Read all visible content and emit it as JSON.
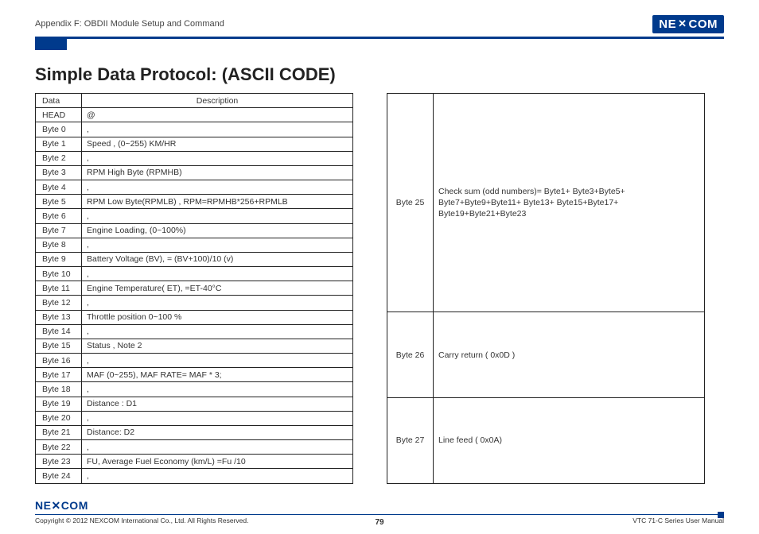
{
  "header": {
    "appendix": "Appendix F: OBDII Module Setup and Command",
    "logo_text": "NE✕COM"
  },
  "title": "Simple Data Protocol: (ASCII CODE)",
  "table_left": {
    "headers": [
      "Data",
      "Description"
    ],
    "rows": [
      [
        "HEAD",
        "@"
      ],
      [
        "Byte 0",
        ","
      ],
      [
        "Byte 1",
        "Speed , (0~255) KM/HR"
      ],
      [
        "Byte 2",
        ","
      ],
      [
        "Byte 3",
        "RPM High Byte (RPMHB)"
      ],
      [
        "Byte 4",
        ","
      ],
      [
        "Byte 5",
        "RPM Low Byte(RPMLB) , RPM=RPMHB*256+RPMLB"
      ],
      [
        "Byte 6",
        ","
      ],
      [
        "Byte 7",
        "Engine Loading, (0~100%)"
      ],
      [
        "Byte 8",
        ","
      ],
      [
        "Byte 9",
        "Battery Voltage (BV), = (BV+100)/10 (v)"
      ],
      [
        "Byte 10",
        ","
      ],
      [
        "Byte 11",
        "Engine Temperature( ET), =ET-40°C"
      ],
      [
        "Byte 12",
        ","
      ],
      [
        "Byte 13",
        "Throttle position 0~100 %"
      ],
      [
        "Byte 14",
        ","
      ],
      [
        "Byte 15",
        "Status , Note 2"
      ],
      [
        "Byte 16",
        ","
      ],
      [
        "Byte 17",
        "MAF (0~255), MAF RATE= MAF * 3;"
      ],
      [
        "Byte 18",
        ","
      ],
      [
        "Byte 19",
        "Distance : D1"
      ],
      [
        "Byte 20",
        ","
      ],
      [
        "Byte 21",
        "Distance: D2"
      ],
      [
        "Byte 22",
        ","
      ],
      [
        "Byte 23",
        "FU, Average Fuel Economy (km/L) =Fu /10"
      ],
      [
        "Byte 24",
        ","
      ]
    ]
  },
  "table_right": {
    "rows": [
      [
        "Byte 25",
        "Check sum (odd numbers)= Byte1+ Byte3+Byte5+ Byte7+Byte9+Byte11+ Byte13+ Byte15+Byte17+ Byte19+Byte21+Byte23"
      ],
      [
        "Byte 26",
        "Carry return ( 0x0D )"
      ],
      [
        "Byte 27",
        "Line feed ( 0x0A)"
      ]
    ]
  },
  "footer": {
    "logo_text": "NE✕COM",
    "copyright": "Copyright © 2012 NEXCOM International Co., Ltd. All Rights Reserved.",
    "page": "79",
    "manual": "VTC 71-C Series User Manual"
  }
}
